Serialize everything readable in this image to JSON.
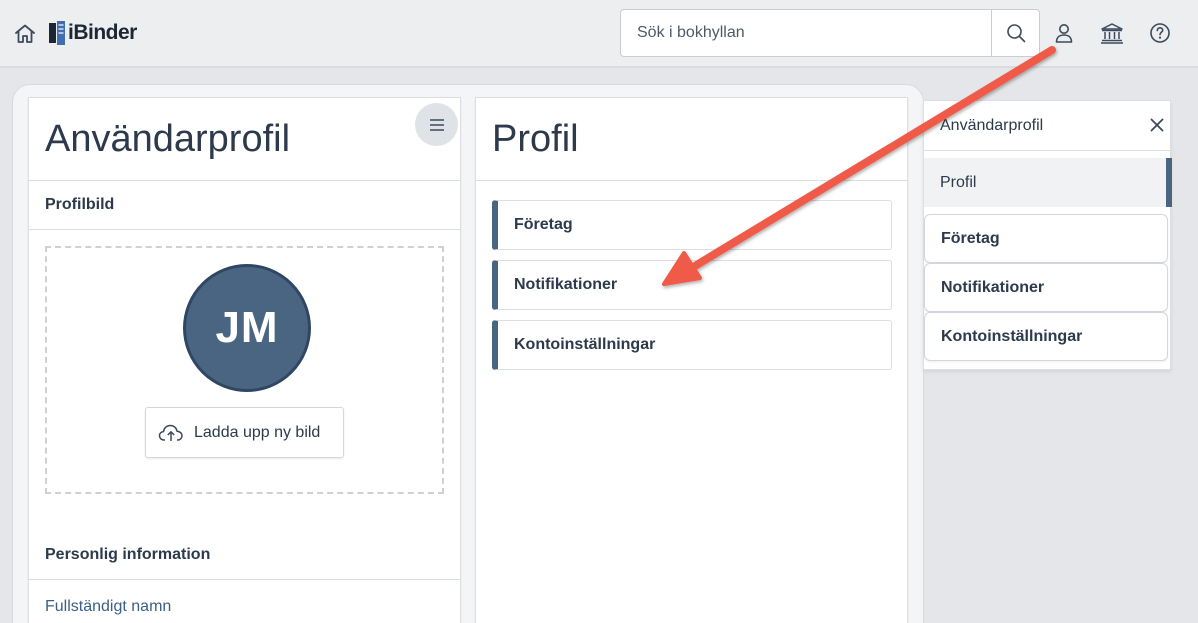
{
  "header": {
    "logo_text": "iBinder",
    "search_placeholder": "Sök i bokhyllan"
  },
  "left_panel": {
    "title": "Användarprofil",
    "profile_picture_label": "Profilbild",
    "avatar_initials": "JM",
    "upload_button_label": "Ladda upp ny bild",
    "personal_info_label": "Personlig information",
    "full_name_label": "Fullständigt namn"
  },
  "middle_panel": {
    "title": "Profil",
    "items": [
      {
        "label": "Företag"
      },
      {
        "label": "Notifikationer"
      },
      {
        "label": "Kontoinställningar"
      }
    ]
  },
  "flyout": {
    "title": "Användarprofil",
    "active_item": "Profil",
    "items": [
      {
        "label": "Företag"
      },
      {
        "label": "Notifikationer"
      },
      {
        "label": "Kontoinställningar"
      }
    ]
  },
  "colors": {
    "accent": "#4a6582",
    "annotation_arrow": "#ef5a48",
    "background": "#e4e6e9"
  }
}
